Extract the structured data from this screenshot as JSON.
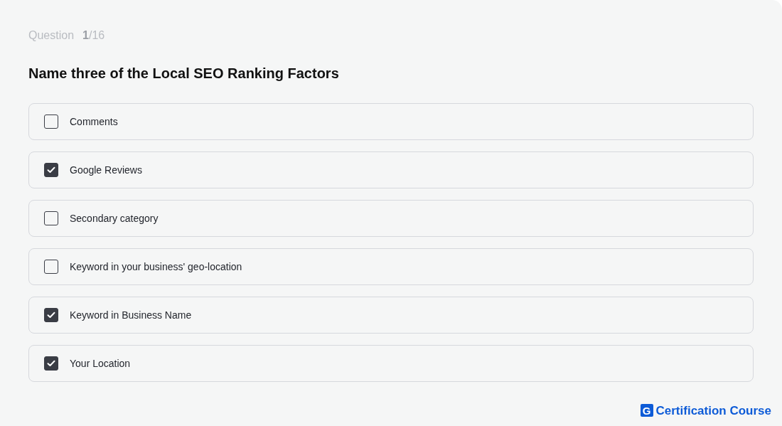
{
  "question_label": "Question",
  "question_counter": "**1**/16",
  "question": "Name three of the Local SEO Ranking Factors",
  "options": [
    {
      "label": "Comments",
      "checked": false
    },
    {
      "label": "Google Reviews",
      "checked": true
    },
    {
      "label": "Secondary category",
      "checked": false
    },
    {
      "label": "Keyword in your business' geo-location",
      "checked": false
    },
    {
      "label": "Keyword in Business Name",
      "checked": true
    },
    {
      "label": "Your Location",
      "checked": true
    }
  ],
  "brand": {
    "mark": "G",
    "name": "Certification Course"
  }
}
